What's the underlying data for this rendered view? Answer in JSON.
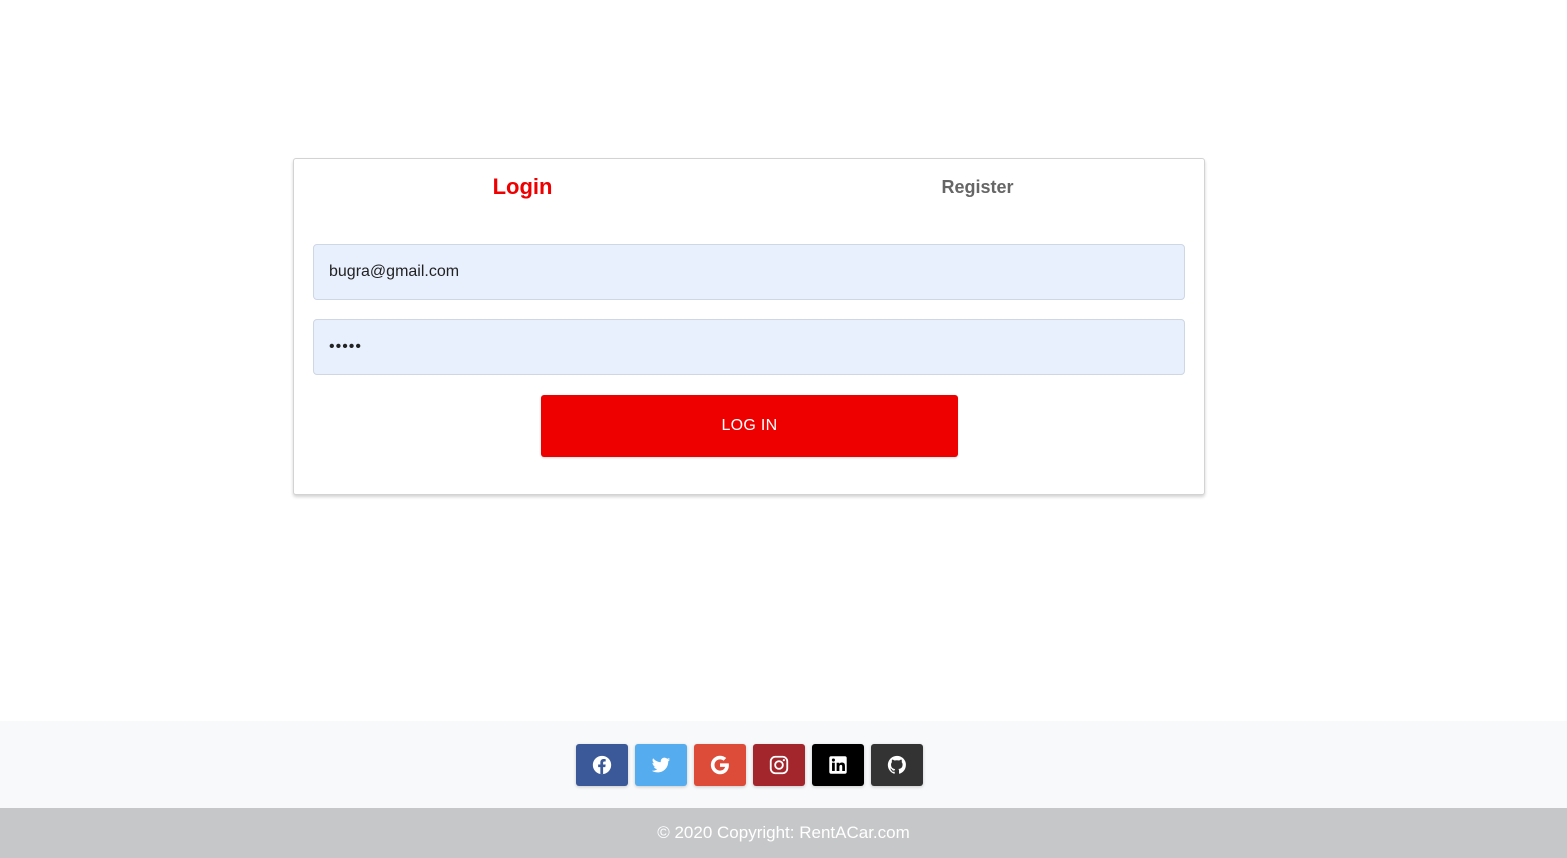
{
  "tabs": {
    "login_label": "Login",
    "register_label": "Register"
  },
  "form": {
    "email_value": "bugra@gmail.com",
    "password_value": "*****",
    "login_button_label": "LOG IN"
  },
  "social": {
    "buttons": [
      {
        "name": "facebook",
        "icon": "facebook-icon",
        "color": "#3b5998"
      },
      {
        "name": "twitter",
        "icon": "twitter-icon",
        "color": "#55acee"
      },
      {
        "name": "google",
        "icon": "google-icon",
        "color": "#dd4b39"
      },
      {
        "name": "instagram",
        "icon": "instagram-icon",
        "color": "#ac2bac"
      },
      {
        "name": "linkedin",
        "icon": "linkedin-icon",
        "color": "#0082ca"
      },
      {
        "name": "github",
        "icon": "github-icon",
        "color": "#333333"
      }
    ]
  },
  "footer": {
    "copyright_text": "© 2020 Copyright: RentACar.com"
  },
  "colors": {
    "accent": "#ee0000",
    "tab_inactive": "#666666",
    "input_bg": "#e8f0fe",
    "footer_bg": "#f8f9fa",
    "copyright_bg": "#c6c7c9"
  }
}
